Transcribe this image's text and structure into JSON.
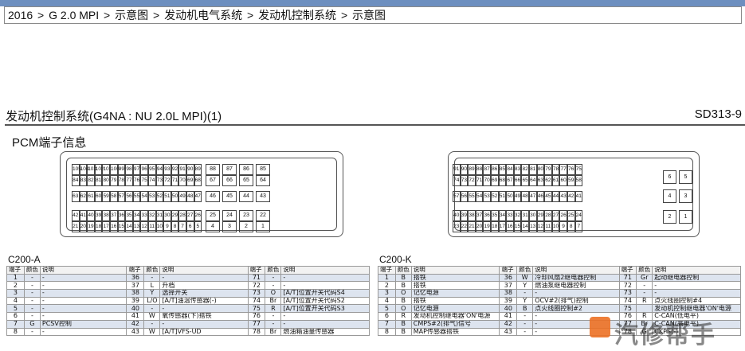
{
  "breadcrumb": [
    "2016",
    "G 2.0 MPI",
    "示意图",
    "发动机电气系统",
    "发动机控制系统",
    "示意图"
  ],
  "breadcrumb_sep": ">",
  "doc": {
    "title": "发动机控制系统(G4NA : NU 2.0L MPI)(1)",
    "code": "SD313-9",
    "section": "PCM端子信息"
  },
  "connector_a_rows": [
    [
      "105",
      "104",
      "103",
      "102",
      "101",
      "100",
      "99",
      "98",
      "97",
      "96",
      "95",
      "94",
      "93",
      "92",
      "91",
      "90",
      "89"
    ],
    [
      "84",
      "83",
      "82",
      "81",
      "80",
      "79",
      "78",
      "77",
      "76",
      "75",
      "74",
      "73",
      "72",
      "71",
      "70",
      "69",
      "68"
    ],
    [
      "63",
      "62",
      "61",
      "60",
      "59",
      "58",
      "57",
      "56",
      "55",
      "54",
      "53",
      "52",
      "51",
      "50",
      "49",
      "48",
      "47"
    ],
    [
      "42",
      "41",
      "40",
      "39",
      "38",
      "37",
      "36",
      "35",
      "34",
      "33",
      "32",
      "31",
      "30",
      "29",
      "28",
      "27",
      "26"
    ],
    [
      "21",
      "20",
      "19",
      "18",
      "17",
      "16",
      "15",
      "14",
      "13",
      "12",
      "11",
      "10",
      "9",
      "8",
      "7",
      "6",
      "5"
    ]
  ],
  "connector_a_right": [
    [
      "88",
      "87",
      "86",
      "85"
    ],
    [
      "67",
      "66",
      "65",
      "64"
    ],
    [
      "46",
      "45",
      "44",
      "43"
    ],
    [
      "25",
      "24",
      "23",
      "22"
    ],
    [
      "4",
      "3",
      "2",
      "1"
    ]
  ],
  "connector_k_rows": [
    [
      "91",
      "90",
      "89",
      "88",
      "87",
      "86",
      "85",
      "84",
      "83",
      "82",
      "81",
      "80",
      "79",
      "78",
      "77",
      "76",
      "75"
    ],
    [
      "74",
      "73",
      "72",
      "71",
      "70",
      "69",
      "68",
      "67",
      "66",
      "65",
      "64",
      "63",
      "62",
      "61",
      "60",
      "59",
      "58"
    ],
    [
      "57",
      "56",
      "55",
      "54",
      "53",
      "52",
      "51",
      "50",
      "49",
      "48",
      "47",
      "46",
      "45",
      "44",
      "43",
      "42",
      "41"
    ],
    [
      "40",
      "39",
      "38",
      "37",
      "36",
      "35",
      "34",
      "33",
      "32",
      "31",
      "30",
      "29",
      "28",
      "27",
      "26",
      "25",
      "24"
    ],
    [
      "23",
      "22",
      "21",
      "20",
      "19",
      "18",
      "17",
      "16",
      "15",
      "14",
      "13",
      "12",
      "11",
      "10",
      "9",
      "8",
      "7"
    ]
  ],
  "connector_k_right": [
    [
      "6",
      "5"
    ],
    [
      "4",
      "3"
    ],
    [
      "2",
      "1"
    ]
  ],
  "table_headers": [
    "端子",
    "颜色",
    "说明"
  ],
  "table_a": {
    "title": "C200-A",
    "rows": [
      [
        [
          "1",
          "-",
          "-"
        ],
        [
          "36",
          "-",
          "-"
        ],
        [
          "71",
          "-",
          "-"
        ]
      ],
      [
        [
          "2",
          "-",
          "-"
        ],
        [
          "37",
          "L",
          "升档"
        ],
        [
          "72",
          "-",
          "-"
        ]
      ],
      [
        [
          "3",
          "-",
          "-"
        ],
        [
          "38",
          "Y",
          "选择开关"
        ],
        [
          "73",
          "O",
          "[A/T]位置开关代码S4"
        ]
      ],
      [
        [
          "4",
          "-",
          "-"
        ],
        [
          "39",
          "L/O",
          "[A/T]油温传感器(-)"
        ],
        [
          "74",
          "Br",
          "[A/T]位置开关代码S2"
        ]
      ],
      [
        [
          "5",
          "-",
          "-"
        ],
        [
          "40",
          "-",
          "-"
        ],
        [
          "75",
          "R",
          "[A/T]位置开关代码S3"
        ]
      ],
      [
        [
          "6",
          "-",
          "-"
        ],
        [
          "41",
          "W",
          "氧传感器(下)搭铁"
        ],
        [
          "76",
          "-",
          "-"
        ]
      ],
      [
        [
          "7",
          "G",
          "PCSV控制"
        ],
        [
          "42",
          "-",
          "-"
        ],
        [
          "77",
          "-",
          "-"
        ]
      ],
      [
        [
          "8",
          "-",
          "-"
        ],
        [
          "43",
          "W",
          "[A/T]VFS-UD"
        ],
        [
          "78",
          "Br",
          "燃油箱油量传感器"
        ]
      ]
    ]
  },
  "table_k": {
    "title": "C200-K",
    "rows": [
      [
        [
          "1",
          "B",
          "搭铁"
        ],
        [
          "36",
          "W",
          "冷却风扇2继电器控制"
        ],
        [
          "71",
          "Gr",
          "起动继电器控制"
        ]
      ],
      [
        [
          "2",
          "B",
          "搭铁"
        ],
        [
          "37",
          "Y",
          "燃油泵继电器控制"
        ],
        [
          "72",
          "-",
          "-"
        ]
      ],
      [
        [
          "3",
          "O",
          "记忆电源"
        ],
        [
          "38",
          "-",
          "-"
        ],
        [
          "73",
          "-",
          "-"
        ]
      ],
      [
        [
          "4",
          "B",
          "搭铁"
        ],
        [
          "39",
          "Y",
          "OCV#2(排气)控制"
        ],
        [
          "74",
          "R",
          "点火线圈控制#4"
        ]
      ],
      [
        [
          "5",
          "O",
          "记忆电源"
        ],
        [
          "40",
          "B",
          "点火线圈控制#2"
        ],
        [
          "75",
          "",
          "发动机控制继电器'ON'电源"
        ]
      ],
      [
        [
          "6",
          "R",
          "发动机控制继电器'ON'电源"
        ],
        [
          "41",
          "-",
          "-"
        ],
        [
          "76",
          "R",
          "C-CAN(低电平)"
        ]
      ],
      [
        [
          "7",
          "B",
          "CMPS#2(排气)信号"
        ],
        [
          "42",
          "-",
          "-"
        ],
        [
          "77",
          "Br",
          "C-CAN(高电平)"
        ]
      ],
      [
        [
          "8",
          "B",
          "MAP传感器搭铁"
        ],
        [
          "43",
          "-",
          "-"
        ],
        [
          "78",
          "G",
          "CKPS(-)"
        ]
      ]
    ]
  },
  "watermark_text": "汽修帮手",
  "colors": {
    "topbar": "#6d8fbf",
    "row_alt": "#dde4ef",
    "watermark_mark": "#ec7024"
  }
}
